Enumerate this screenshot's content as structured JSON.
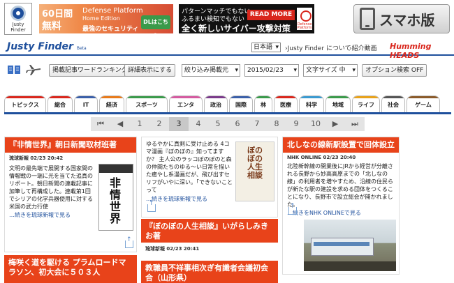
{
  "header": {
    "logo_text": "Justy\nFinder",
    "ad1": {
      "free1": "60日間",
      "free2": "無料",
      "product": "Defense Platform",
      "edition": "Home Edition",
      "tagline": "最強のセキュリティ",
      "button": "DLはこちら"
    },
    "ad2": {
      "line1": "パターンマッチでもない",
      "line2": "ふるまい検知でもない",
      "line3": "全く新しいサイバー攻撃対策",
      "button": "READ MORE",
      "brand": "Defense Platform"
    },
    "smartphone_label": "スマホ版"
  },
  "brandbar": {
    "title": "Justy Finder",
    "beta": "Beta",
    "language": "日本語",
    "about_link": "›Justy Finder について",
    "video_link": "›紹介動画",
    "sponsor": "Humming HEADS"
  },
  "toolbar": {
    "ranking_button": "掲載記事ワードランキング",
    "detail_button": "詳細表示にする",
    "filter_select": "絞り込み掲載元",
    "date_select": "2015/02/23",
    "font_select": "文字サイズ 中",
    "option_button": "オプション検索 OFF"
  },
  "tabs": [
    {
      "label": "トピックス",
      "color": "#d9261c"
    },
    {
      "label": "総合",
      "color": "#d9261c"
    },
    {
      "label": "IT",
      "color": "#3a5fa8"
    },
    {
      "label": "経済",
      "color": "#e87a1a"
    },
    {
      "label": "スポーツ",
      "color": "#3a9a4a"
    },
    {
      "label": "エンタ",
      "color": "#d45aa0"
    },
    {
      "label": "政治",
      "color": "#7a3a8a"
    },
    {
      "label": "国際",
      "color": "#3a5fa8"
    },
    {
      "label": "林",
      "color": "#3a9a4a"
    },
    {
      "label": "医療",
      "color": "#d9261c"
    },
    {
      "label": "科学",
      "color": "#3a9ad0"
    },
    {
      "label": "地域",
      "color": "#3a9a4a"
    },
    {
      "label": "ライフ",
      "color": "#e8a21a"
    },
    {
      "label": "社会",
      "color": "#555555"
    },
    {
      "label": "ゲーム",
      "color": "#8a5a2a"
    }
  ],
  "pager": {
    "first": "⏮",
    "prev": "◀",
    "pages": [
      "1",
      "2",
      "3",
      "4",
      "5",
      "6",
      "7",
      "8",
      "9",
      "10"
    ],
    "next": "▶",
    "last": "⏭",
    "current": "3"
  },
  "articles": {
    "a1": {
      "title": "『非情世界』朝日新聞取材班著",
      "meta": "琉球新報 02/23 20:42",
      "body": "文明の最先端で展開する国家間の情報戦の一端に光を当てた追真のリポート。朝日新聞の連載記事に加筆して再構成した。連載第1回でシリアの化学兵器使用に対する米国の武力行使",
      "more": "…続きを琉球新報で見る",
      "book_title": "非情世界"
    },
    "a2": {
      "body": "ゆるやかに真剣に受け止める 4コマ漫画『ぼのぼの』知ってますか？ 主人公のラッコぼのぼのと森の仲間たちのゆる〜い日常を描いた癒やし系漫画だが、飛び出すセリフがいやに深い。「できないことって",
      "more": "…続きを琉球新報で見る",
      "book_title": "ぼのぼの人生相談"
    },
    "a3": {
      "title": "『ぼのぼの人生相談』いがらしみきお著",
      "meta": "琉球新報 02/23 20:41"
    },
    "a4": {
      "title": "北しなの線新駅設置で回体設立",
      "meta": "NHK ONLINE 02/23 20:40",
      "body": "北陸新幹線の開業後にJRから経営が分離される長野から妙高高原までの「北しなの線」の利用者を増やすため、沿線の住民らが新たな駅の建設を求める団体をつくることになり、長野市で設立総会が開かれました。",
      "more": "…続きをNHK ONLINEで見る"
    },
    "a5": {
      "title": "梅咲く道を駆ける プラムロードマラソン、初大会に５０３人"
    },
    "a6": {
      "title": "教職員不祥事相次ぎ有識者会議初会合（山形県）"
    }
  }
}
